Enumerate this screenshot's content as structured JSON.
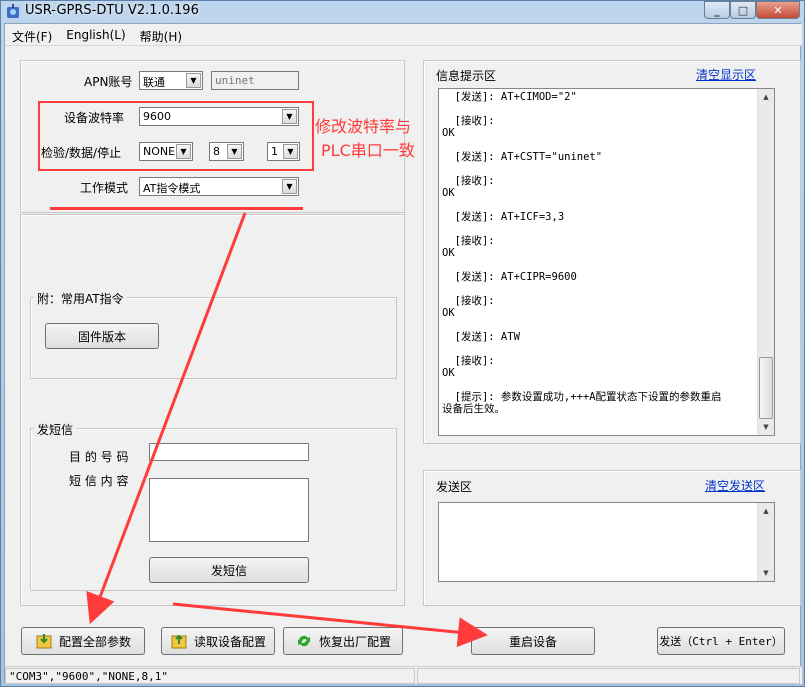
{
  "window": {
    "title": "USR-GPRS-DTU V2.1.0.196"
  },
  "menu": [
    {
      "label": "文件(F)"
    },
    {
      "label": "English(L)"
    },
    {
      "label": "帮助(H)"
    }
  ],
  "params": {
    "apn_label": "APN账号",
    "apn_carrier": "联通",
    "apn_value": "uninet",
    "baud_label": "设备波特率",
    "baud_value": "9600",
    "parity_label": "检验/数据/停止",
    "parity_value": "NONE",
    "databits_value": "8",
    "stopbits_value": "1",
    "mode_label": "工作模式",
    "mode_value": "AT指令模式"
  },
  "annotation": {
    "line1": "修改波特率与",
    "line2": "PLC串口一致",
    "color": "#ff3b3b"
  },
  "at_group": {
    "title": "附：常用AT指令",
    "firmware_button": "固件版本"
  },
  "sms_group": {
    "title": "发短信",
    "number_label": "目 的 号 码",
    "content_label": "短 信 内 容",
    "send_button": "发短信"
  },
  "info_panel": {
    "title": "信息提示区",
    "clear_link": "清空显示区",
    "log": [
      "  [发送]: AT+CIMOD=\"2\"",
      "",
      "  [接收]:",
      "OK",
      "",
      "  [发送]: AT+CSTT=\"uninet\"",
      "",
      "  [接收]:",
      "OK",
      "",
      "  [发送]: AT+ICF=3,3",
      "",
      "  [接收]:",
      "OK",
      "",
      "  [发送]: AT+CIPR=9600",
      "",
      "  [接收]:",
      "OK",
      "",
      "  [发送]: ATW",
      "",
      "  [接收]:",
      "OK",
      "",
      "  [提示]: 参数设置成功,+++A配置状态下设置的参数重启",
      "设备后生效。"
    ]
  },
  "send_panel": {
    "title": "发送区",
    "clear_link": "清空发送区",
    "send_button": "发送（Ctrl + Enter）"
  },
  "bottom_buttons": {
    "config_all": "配置全部参数",
    "read_config": "读取设备配置",
    "restore_factory": "恢复出厂配置",
    "restart": "重启设备"
  },
  "statusbar": {
    "text": "\"COM3\",\"9600\",\"NONE,8,1\""
  }
}
